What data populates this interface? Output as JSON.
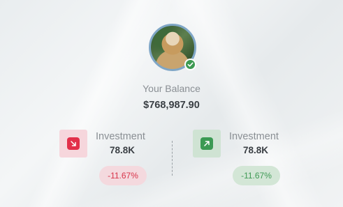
{
  "profile": {
    "status": "verified"
  },
  "balance": {
    "label": "Your Balance",
    "value": "$768,987.90"
  },
  "stats": [
    {
      "label": "Investment",
      "value": "78.8K",
      "change": "-11.67%",
      "direction": "down",
      "accent": "#e2304a"
    },
    {
      "label": "Investment",
      "value": "78.8K",
      "change": "-11.67%",
      "direction": "up",
      "accent": "#3b9a53"
    }
  ],
  "colors": {
    "negative": "#d8344a",
    "positive": "#3f9a55",
    "avatar_ring": "#7fa6c6"
  }
}
